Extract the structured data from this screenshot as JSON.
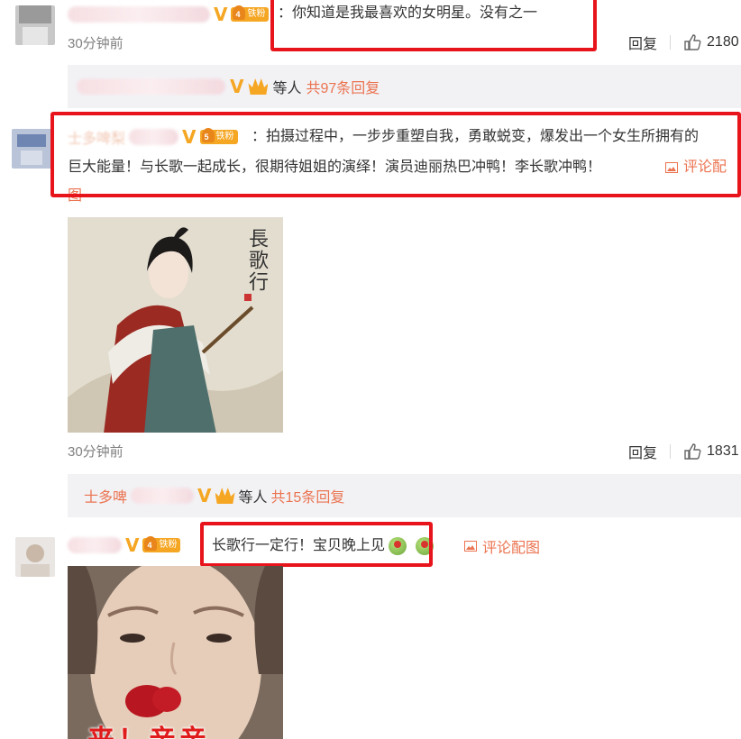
{
  "comments": [
    {
      "fan_badge": "铁粉",
      "fan_level": "4",
      "text": "：你知道是我最喜欢的女明星。没有之一",
      "time": "30分钟前",
      "reply_label": "回复",
      "likes": "2180",
      "replies_summary": {
        "suffix": "等人",
        "count_text": "共97条回复"
      }
    },
    {
      "username_visible": "士多啤梨",
      "fan_badge": "铁粉",
      "fan_level": "5",
      "text_line1": "：拍摄过程中，一步步重塑自我，勇敢蜕变，爆发出一个女生所拥有的",
      "text_line2": "巨大能量！与长歌一起成长，很期待姐姐的演绎！演员迪丽热巴冲鸭！李长歌冲鸭！",
      "pic_link_a": "评论配",
      "pic_link_b": "图",
      "poster": {
        "title": "長歌行"
      },
      "time": "30分钟前",
      "reply_label": "回复",
      "likes": "1831",
      "replies_summary": {
        "username_visible": "士多啤",
        "suffix": "等人",
        "count_text": "共15条回复"
      }
    },
    {
      "fan_badge": "铁粉",
      "fan_level": "4",
      "text": "长歌行一定行！宝贝晚上见",
      "pic_link": "评论配图",
      "sticker_caption": "来！亲亲"
    }
  ],
  "colors": {
    "accent": "#eb7350",
    "highlight_box": "#e8141b",
    "v_badge": "#f5a623"
  }
}
